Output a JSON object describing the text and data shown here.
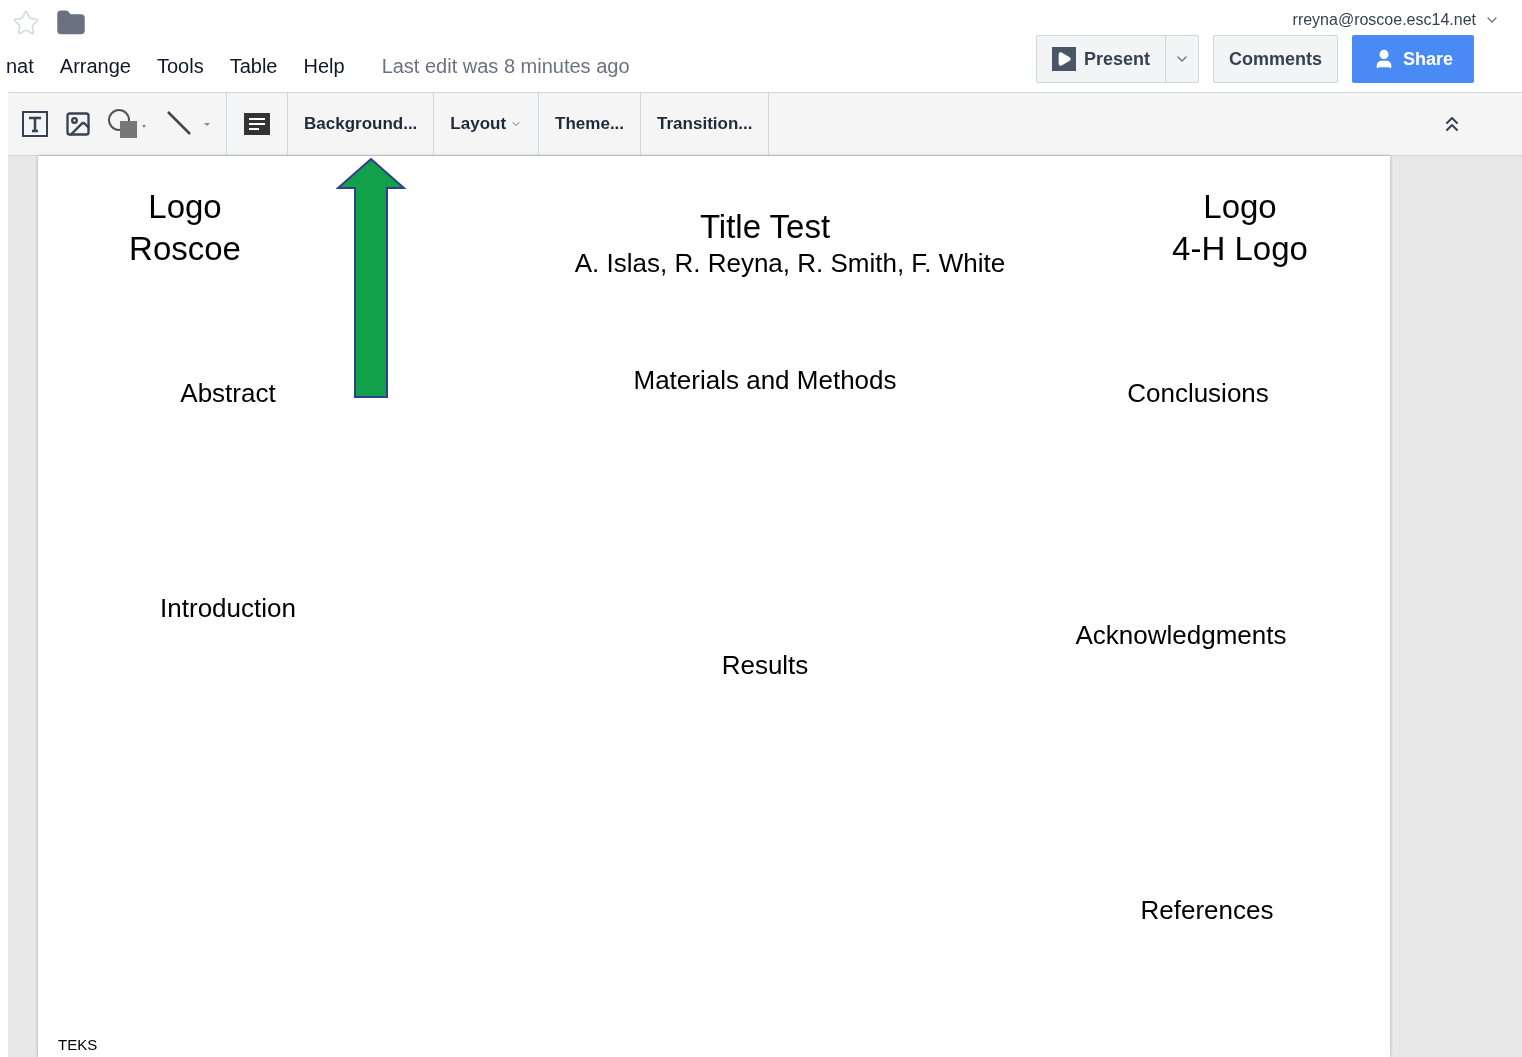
{
  "account": {
    "email": "rreyna@roscoe.esc14.net"
  },
  "menu": [
    "nat",
    "Arrange",
    "Tools",
    "Table",
    "Help"
  ],
  "last_edit": "Last edit was 8 minutes ago",
  "header_buttons": {
    "present": "Present",
    "comments": "Comments",
    "share": "Share"
  },
  "toolbar": [
    "Background...",
    "Layout",
    "Theme...",
    "Transition..."
  ],
  "slide": {
    "items": [
      {
        "lines": [
          "Logo",
          "Roscoe"
        ],
        "kind": "heading"
      },
      {
        "lines": [
          "Title Test"
        ],
        "kind": "heading"
      },
      {
        "lines": [
          "A. Islas, R. Reyna, R. Smith, F. White"
        ],
        "kind": "section"
      },
      {
        "lines": [
          "Logo",
          "4-H Logo"
        ],
        "kind": "heading"
      },
      {
        "lines": [
          "Abstract"
        ],
        "kind": "section"
      },
      {
        "lines": [
          "Materials and Methods"
        ],
        "kind": "section"
      },
      {
        "lines": [
          "Conclusions"
        ],
        "kind": "section"
      },
      {
        "lines": [
          "Introduction"
        ],
        "kind": "section"
      },
      {
        "lines": [
          "Results"
        ],
        "kind": "section"
      },
      {
        "lines": [
          "Acknowledgments"
        ],
        "kind": "section"
      },
      {
        "lines": [
          "References"
        ],
        "kind": "section"
      },
      {
        "lines": [
          "TEKS"
        ],
        "kind": "footnote"
      }
    ]
  }
}
